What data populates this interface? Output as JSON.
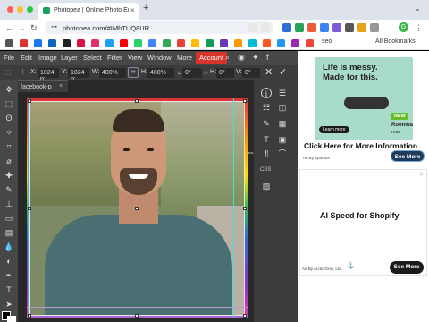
{
  "browser": {
    "tab_title": "Photopea | Online Photo Edi",
    "tab_close": "×",
    "new_tab": "+",
    "tab_menu": "⌄",
    "url": "photopea.com/#IMhTUQ8UR",
    "profile_initial": "G",
    "bookmark_folder": "seo",
    "all_bookmarks": "All Bookmarks"
  },
  "photopea": {
    "menu": [
      "File",
      "Edit",
      "Image",
      "Layer",
      "Select",
      "Filter",
      "View",
      "Window",
      "More"
    ],
    "account": "Account",
    "options": {
      "x_label": "X:",
      "x_value": "1024 p:",
      "y_label": "Y:",
      "y_value": "1024 p:",
      "w_label": "W:",
      "w_value": "400%",
      "h_label": "H:",
      "h_value": "400%",
      "angle_value": "0°",
      "h_skew_label": "H:",
      "h_skew_value": "0°",
      "v_skew_label": "V:",
      "v_skew_value": "0°"
    },
    "doc_tab": "facebook-p",
    "doc_tab_close": "×",
    "css_label": "CSS"
  },
  "ads": {
    "ad1": {
      "headline1": "Life is messy.",
      "headline2": "Made for this.",
      "learn_more": "Learn more",
      "badge_new": "NEW",
      "brand": "Roomba",
      "brand_sub": "max",
      "cta": "Click Here for More Information",
      "by": "Ad By Sponsor",
      "see_more": "See More"
    },
    "ad2": {
      "headline": "AI Speed for Shopify",
      "by": "Ad By Arctic Grey, Ltd.",
      "see_more": "See More",
      "info": "▷"
    }
  },
  "colors": {
    "menu_bg": "#474747",
    "account_red": "#d9342b",
    "guide_cyan": "#3fe0e8"
  }
}
